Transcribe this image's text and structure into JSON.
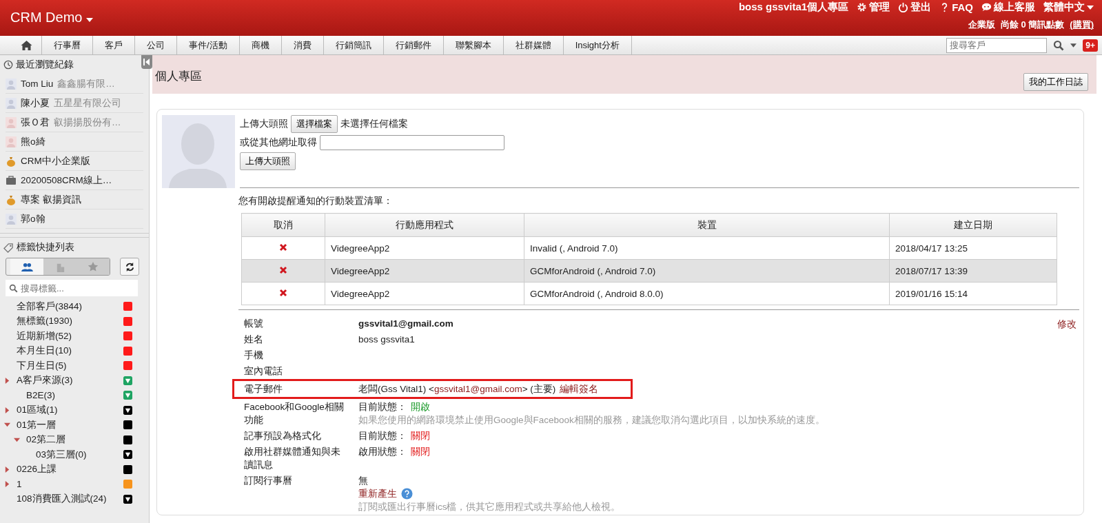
{
  "header": {
    "brand": "CRM Demo",
    "user": "boss gssvita1個人專區",
    "links": [
      {
        "kind": "gear",
        "label": "管理"
      },
      {
        "kind": "power",
        "label": "登出"
      },
      {
        "kind": "question",
        "label": "FAQ"
      },
      {
        "kind": "chat",
        "label": "線上客服"
      },
      {
        "kind": "language",
        "label": "繁體中文"
      }
    ],
    "edition": "企業版",
    "sms": "尚餘 0 簡訊點數",
    "buy": "(購買)"
  },
  "nav": {
    "items": [
      "行事曆",
      "客戶",
      "公司",
      "事件/活動",
      "商機",
      "消費",
      "行銷簡訊",
      "行銷郵件",
      "聯繫腳本",
      "社群媒體",
      "Insight分析"
    ],
    "search": {
      "placeholder": "搜尋客戶"
    },
    "badge": "9+"
  },
  "sidebar": {
    "recent_title": "最近瀏覽紀錄",
    "recent": [
      {
        "kind": "contact",
        "name": "Tom Liu",
        "company": "鑫鑫腸有限…"
      },
      {
        "kind": "contact",
        "name": "陳小夏",
        "company": "五星星有限公司"
      },
      {
        "kind": "contact-alt",
        "name": "張Ｏ君",
        "company": "叡揚揚股份有…"
      },
      {
        "kind": "contact-alt",
        "name": "熊o綺"
      },
      {
        "kind": "deal",
        "name": "CRM中小企業版"
      },
      {
        "kind": "case",
        "name": "20200508CRM線上…"
      },
      {
        "kind": "deal",
        "name": "專案 叡揚資訊"
      },
      {
        "kind": "contact",
        "name": "郭o翰"
      }
    ],
    "tags_title": "標籤快捷列表",
    "tag_tabs": [
      {
        "kind": "people",
        "selected": true
      },
      {
        "kind": "building",
        "selected": false
      },
      {
        "kind": "star",
        "selected": false
      }
    ],
    "tag_search": {
      "placeholder": "搜尋標籤..."
    },
    "tags": [
      {
        "label": "全部客戶(3844)",
        "kind": "square",
        "color": "#ff1a1a"
      },
      {
        "label": "無標籤(1930)",
        "kind": "square",
        "color": "#ff1a1a"
      },
      {
        "label": "近期新增(52)",
        "kind": "square",
        "color": "#ff1a1a"
      },
      {
        "label": "本月生日(10)",
        "kind": "square",
        "color": "#ff1a1a"
      },
      {
        "label": "下月生日(5)",
        "kind": "square",
        "color": "#ff1a1a"
      },
      {
        "label": "A客戶來源(3)",
        "kind": "filter",
        "color": "#1fa463",
        "expanded": false,
        "children": [
          {
            "label": "B2E(3)",
            "kind": "filter",
            "color": "#1fa463"
          }
        ]
      },
      {
        "label": "01區域(1)",
        "kind": "filter",
        "color": "#000000",
        "expanded": false
      },
      {
        "label": "01第一層",
        "kind": "square",
        "color": "#000000",
        "expanded": true,
        "children": [
          {
            "label": "02第二層",
            "kind": "square",
            "color": "#000000",
            "expanded": true,
            "children": [
              {
                "label": "03第三層(0)",
                "kind": "filter",
                "color": "#000000"
              }
            ]
          }
        ]
      },
      {
        "label": "0226上課",
        "kind": "square",
        "color": "#000000",
        "expanded": false
      },
      {
        "label": "1",
        "kind": "square",
        "color": "#f7941d",
        "expanded": false
      },
      {
        "label": "108消費匯入測試(24)",
        "kind": "filter",
        "color": "#000000"
      }
    ]
  },
  "page": {
    "title": "個人專區",
    "journal_button": "我的工作日誌",
    "upload": {
      "label": "上傳大頭照",
      "choose_button": "選擇檔案",
      "no_file": "未選擇任何檔案",
      "url_label": "或從其他網址取得",
      "submit": "上傳大頭照"
    },
    "devices": {
      "heading": "您有開啟提醒通知的行動裝置清單：",
      "columns": [
        "取消",
        "行動應用程式",
        "裝置",
        "建立日期"
      ],
      "rows": [
        {
          "app": "VidegreeApp2",
          "device": "Invalid (, Android 7.0)",
          "date": "2018/04/17 13:25",
          "highlighted": false
        },
        {
          "app": "VidegreeApp2",
          "device": "GCMforAndroid (, Android 7.0)",
          "date": "2018/07/17 13:39",
          "highlighted": true
        },
        {
          "app": "VidegreeApp2",
          "device": "GCMforAndroid (, Android 8.0.0)",
          "date": "2019/01/16 15:14",
          "highlighted": false
        }
      ]
    },
    "edit_link": "修改",
    "fields": [
      {
        "kind": "bold",
        "label": "帳號",
        "value": "gssvital1@gmail.com"
      },
      {
        "kind": "text",
        "label": "姓名",
        "value": "boss gssvita1"
      },
      {
        "kind": "text",
        "label": "手機"
      },
      {
        "kind": "text",
        "label": "室內電話"
      },
      {
        "kind": "email",
        "label": "電子郵件",
        "name": "老闆(Gss Vital1) <",
        "email": "gssvital1@gmail.com",
        "suffix": "> (主要)",
        "link": "編輯簽名",
        "outlined": true
      },
      {
        "kind": "status",
        "label": "Facebook和Google相關功能",
        "status_label": "目前狀態：",
        "status": "開啟",
        "on": true,
        "note": "如果您使用的網路環境禁止使用Google與Facebook相關的服務，建議您取消勾選此項目，以加快系統的速度。"
      },
      {
        "kind": "status",
        "label": "記事預設為格式化",
        "status_label": "目前狀態：",
        "status": "關閉",
        "on": false
      },
      {
        "kind": "status",
        "label": "啟用社群媒體通知與未讀訊息",
        "status_label": "啟用狀態：",
        "status": "關閉",
        "on": false
      },
      {
        "kind": "calendar",
        "label": "訂閱行事曆",
        "value": "無",
        "link": "重新產生",
        "note": "訂閱或匯出行事曆ics檔，供其它應用程式或共享給他人檢視。"
      }
    ]
  }
}
